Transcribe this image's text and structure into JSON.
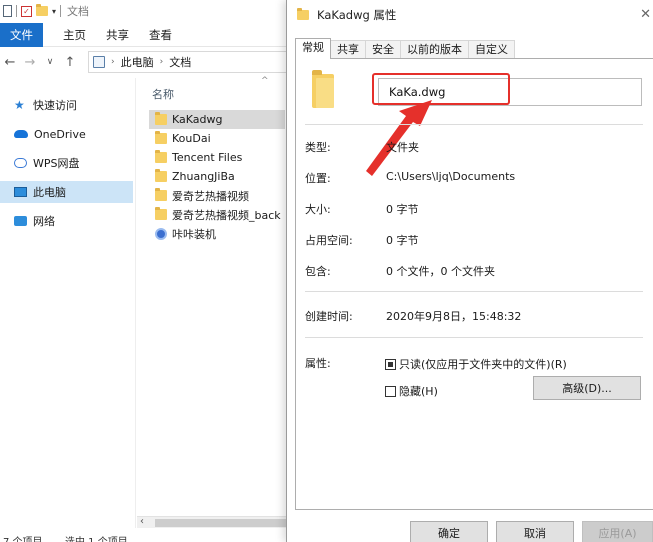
{
  "explorer": {
    "window_title": "文档",
    "ribbon_tabs": [
      "文件",
      "主页",
      "共享",
      "查看"
    ],
    "address": {
      "parts": [
        "此电脑",
        "文档"
      ]
    },
    "nav_pane": [
      "快速访问",
      "OneDrive",
      "WPS网盘",
      "此电脑",
      "网络"
    ],
    "column_header": "名称",
    "files": [
      "KaKadwg",
      "KouDai",
      "Tencent Files",
      "ZhuangJiBa",
      "爱奇艺热播视频",
      "爱奇艺热播视频_back",
      "咔咔装机"
    ],
    "status": {
      "count": "7 个项目",
      "selected": "选中 1 个项目"
    }
  },
  "dialog": {
    "title": "KaKadwg 属性",
    "tabs": [
      "常规",
      "共享",
      "安全",
      "以前的版本",
      "自定义"
    ],
    "name_value": "KaKa.dwg",
    "rows": [
      {
        "label": "类型:",
        "value": "文件夹"
      },
      {
        "label": "位置:",
        "value": "C:\\Users\\ljq\\Documents"
      },
      {
        "label": "大小:",
        "value": "0 字节"
      },
      {
        "label": "占用空间:",
        "value": "0 字节"
      },
      {
        "label": "包含:",
        "value": "0 个文件，0 个文件夹"
      }
    ],
    "created": {
      "label": "创建时间:",
      "value": "2020年9月8日，15:48:32"
    },
    "attributes": {
      "label": "属性:",
      "readonly": "只读(仅应用于文件夹中的文件)(R)",
      "hidden": "隐藏(H)",
      "advanced_button": "高级(D)..."
    },
    "buttons": {
      "ok": "确定",
      "cancel": "取消",
      "apply": "应用(A)"
    }
  },
  "colors": {
    "accent": "#1a6fc9",
    "annotation": "#e5302b",
    "selection": "#cce4f7",
    "folder": "#f6cf63"
  }
}
